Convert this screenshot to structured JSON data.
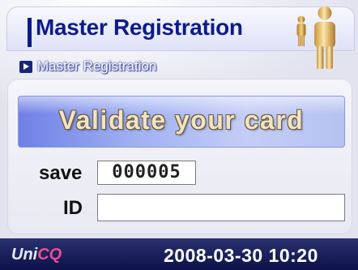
{
  "header": {
    "title": "Master Registration",
    "icon": "users-icon"
  },
  "breadcrumb": {
    "icon": "arrow-right-icon",
    "label": "Master Registration"
  },
  "banner": {
    "text": "Validate your card"
  },
  "form": {
    "save_label": "save",
    "save_value": "000005",
    "id_label": "ID",
    "id_value": ""
  },
  "status_bar": {
    "brand_prefix": "Uni",
    "brand_accent": "CQ",
    "datetime": "2008-03-30 10:20"
  },
  "colors": {
    "title": "#0d1b8a",
    "status_bar": "#0c1147",
    "brand_accent": "#f04a96",
    "banner_text": "#f0e3c6"
  }
}
